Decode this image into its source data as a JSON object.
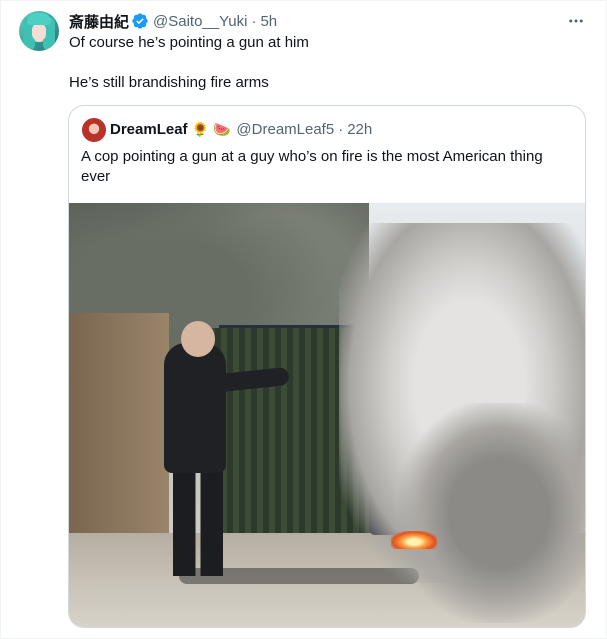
{
  "tweet": {
    "author_name": "斎藤由紀",
    "author_handle": "@Saito__Yuki",
    "separator": "·",
    "timestamp": "5h",
    "text_line1": "Of course he’s pointing a gun at him",
    "text_line2": "He’s still brandishing fire arms"
  },
  "quote": {
    "author_name": "DreamLeaf",
    "emoji1": "🌻",
    "emoji2": "🍉",
    "author_handle": "@DreamLeaf5",
    "separator": "·",
    "timestamp": "22h",
    "text_line1": "A cop pointing a gun at a guy who’s on fire is the most American thing",
    "text_line2": "ever"
  },
  "colors": {
    "verified": "#1d9bf0",
    "secondary_text": "#536471",
    "border": "#cfd9de"
  },
  "icons": {
    "verified": "verified-badge-icon",
    "more": "more-options-icon"
  }
}
